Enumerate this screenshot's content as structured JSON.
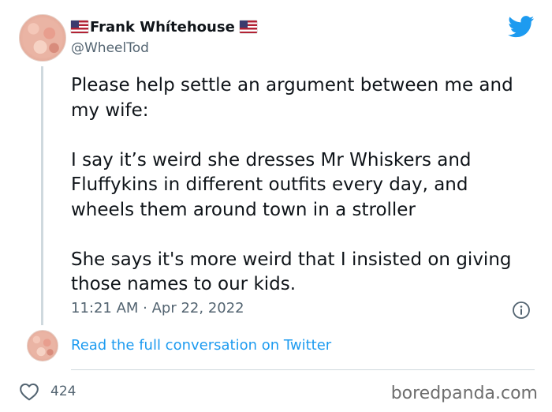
{
  "author": {
    "name": "Frank Whítehouse",
    "handle": "@WheelTod",
    "flag_icon": "us-flag-icon"
  },
  "brand_icon": "twitter-bird-icon",
  "tweet": {
    "paragraphs": [
      "Please help settle an argument between me and my wife:",
      "I say it’s weird she dresses Mr Whiskers and Fluffykins in different outfits every day, and wheels them around town in a stroller",
      "She says it's more weird that I insisted on giving those names to our kids."
    ],
    "timestamp": "11:21 AM · Apr 22, 2022"
  },
  "read_link": "Read the full conversation on Twitter",
  "likes": "424",
  "watermark": "boredpanda.com",
  "colors": {
    "accent": "#1d9bf0",
    "muted": "#536471",
    "text": "#0f1419",
    "divider": "#cfd9de"
  }
}
